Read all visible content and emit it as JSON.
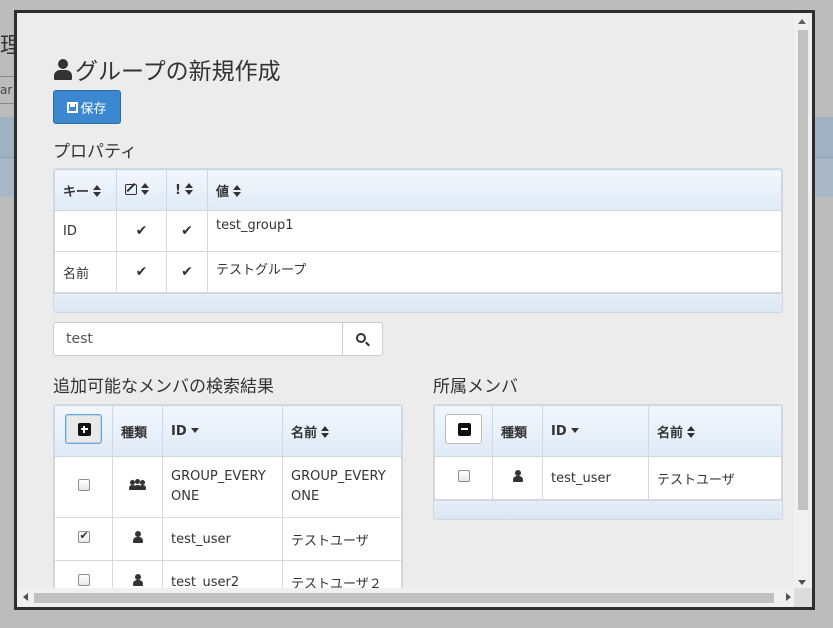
{
  "background": {
    "title_fragment": "理",
    "input_fragment": "ar"
  },
  "dialog": {
    "title": "グループの新規作成",
    "save_label": "保存",
    "properties_label": "プロパティ",
    "properties_table": {
      "headers": [
        "キー",
        "",
        "!",
        "値"
      ],
      "rows": [
        {
          "key": "ID",
          "editable": true,
          "required": true,
          "value": "test_group1"
        },
        {
          "key": "名前",
          "editable": true,
          "required": true,
          "value": "テストグループ"
        }
      ]
    },
    "search": {
      "value": "test"
    },
    "available_label": "追加可能なメンバの検索結果",
    "available_table": {
      "headers": [
        "",
        "種類",
        "ID",
        "名前"
      ],
      "rows": [
        {
          "checked": false,
          "type": "group-icon",
          "id": "GROUP_EVERYONE",
          "name": "GROUP_EVERYONE"
        },
        {
          "checked": true,
          "type": "user-icon",
          "id": "test_user",
          "name": "テストユーザ"
        },
        {
          "checked": false,
          "type": "user-icon",
          "id": "test_user2",
          "name": "テストユーザ２"
        }
      ]
    },
    "members_label": "所属メンバ",
    "members_table": {
      "headers": [
        "",
        "種類",
        "ID",
        "名前"
      ],
      "rows": [
        {
          "checked": false,
          "type": "user-icon",
          "id": "test_user",
          "name": "テストユーザ"
        }
      ]
    }
  }
}
